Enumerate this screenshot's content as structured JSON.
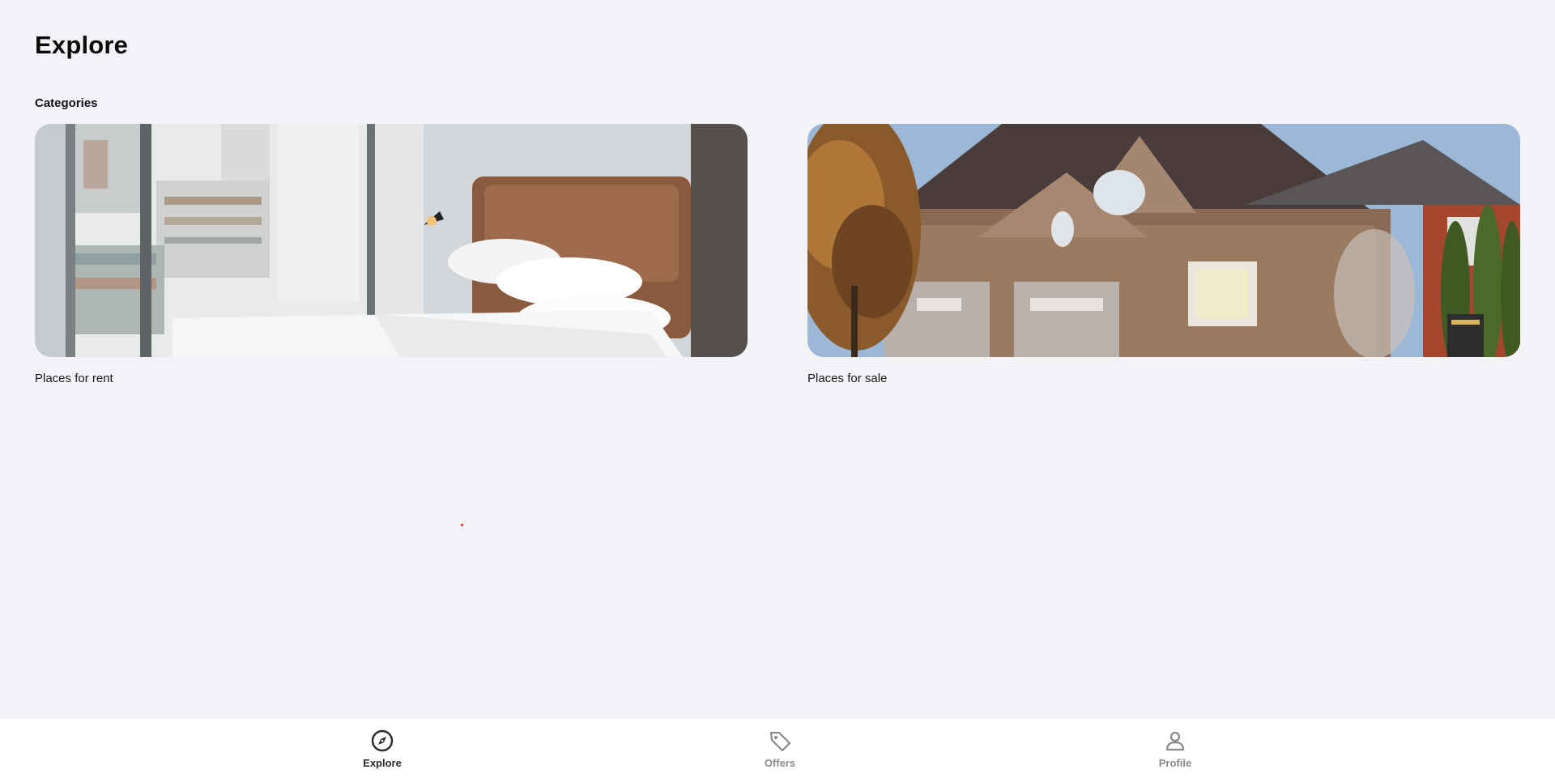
{
  "header": {
    "title": "Explore"
  },
  "categories": {
    "label": "Categories",
    "items": [
      {
        "label": "Places for rent",
        "image": "bedroom-photo"
      },
      {
        "label": "Places for sale",
        "image": "house-photo"
      }
    ]
  },
  "bottom_nav": {
    "items": [
      {
        "label": "Explore",
        "icon": "compass-icon",
        "active": true
      },
      {
        "label": "Offers",
        "icon": "tag-icon",
        "active": false
      },
      {
        "label": "Profile",
        "icon": "person-icon",
        "active": false
      }
    ]
  },
  "colors": {
    "background": "#f2f3f7",
    "nav_background": "#ffffff",
    "active_nav": "#2a2a2a",
    "inactive_nav": "#8a8a8e"
  }
}
